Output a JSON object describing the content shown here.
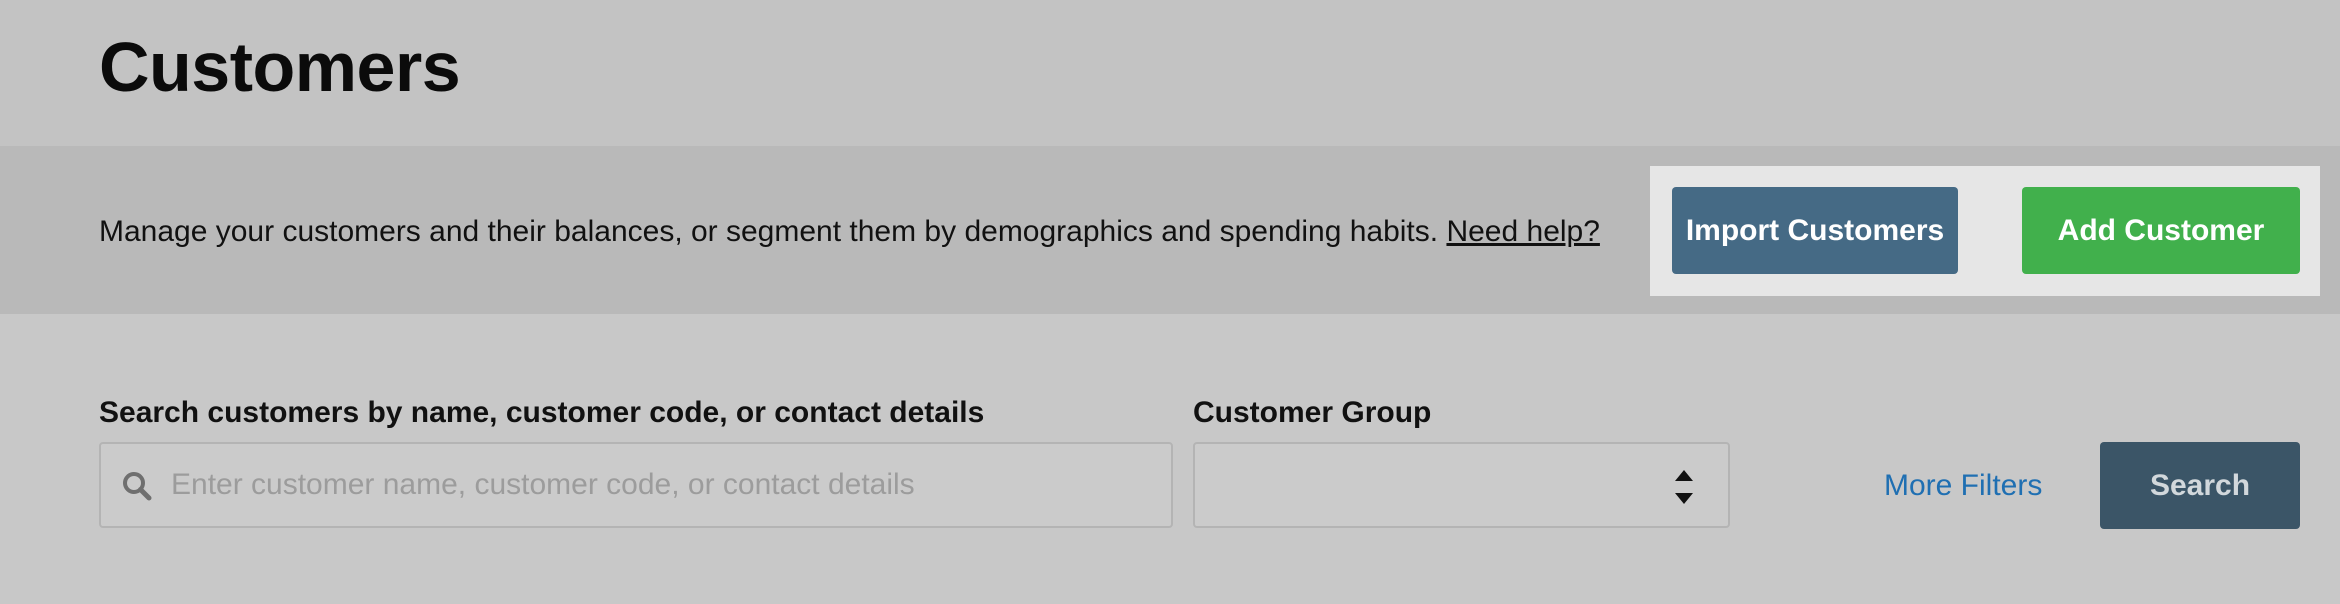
{
  "page": {
    "title": "Customers"
  },
  "info": {
    "description": "Manage your customers and their balances, or segment them by demographics and spending habits.",
    "help_link": "Need help?"
  },
  "actions": {
    "import_label": "Import Customers",
    "add_label": "Add Customer",
    "import_color": "#456a85",
    "add_color": "#41b04c"
  },
  "filters": {
    "search_label": "Search customers by name, customer code, or contact details",
    "search_placeholder": "Enter customer name, customer code, or contact details",
    "search_value": "",
    "search_icon": "search-icon",
    "group_label": "Customer Group",
    "group_value": "",
    "group_icon": "select-arrows-icon",
    "more_filters_label": "More Filters",
    "search_button_label": "Search",
    "link_color": "#1f6fb2",
    "search_button_color": "#3b5567"
  }
}
